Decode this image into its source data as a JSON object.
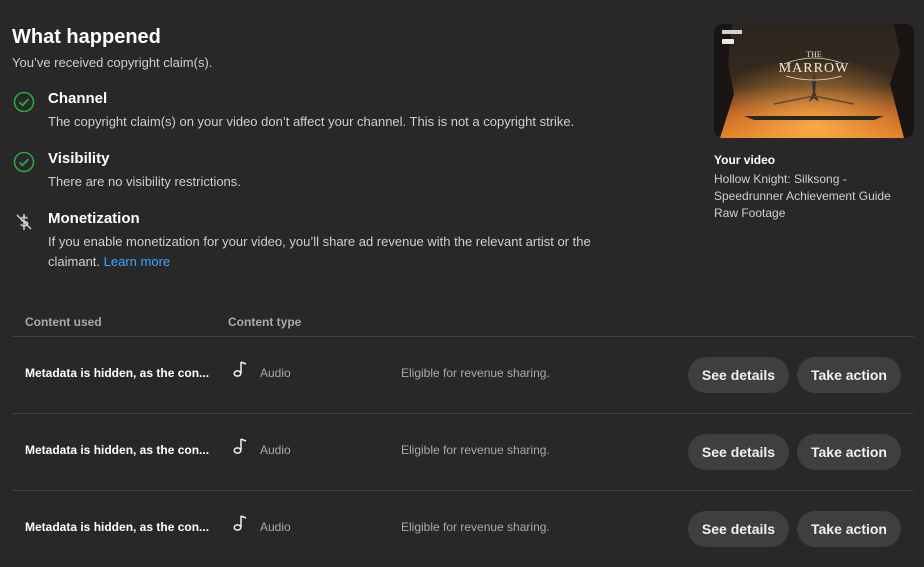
{
  "header": {
    "title": "What happened",
    "subtitle": "You’ve received copyright claim(s)."
  },
  "statuses": [
    {
      "title": "Channel",
      "desc": "The copyright claim(s) on your video don’t affect your channel. This is not a copyright strike."
    },
    {
      "title": "Visibility",
      "desc": "There are no visibility restrictions."
    },
    {
      "title": "Monetization",
      "desc": "If you enable monetization for your video, you’ll share ad revenue with the relevant artist or the claimant.",
      "link": "Learn more"
    }
  ],
  "video": {
    "label": "Your video",
    "title": "Hollow Knight: Silksong - Speedrunner Achievement Guide Raw Footage",
    "thumbnail_text_top": "THE",
    "thumbnail_text": "MARROW"
  },
  "table": {
    "headers": {
      "content_used": "Content used",
      "content_type": "Content type"
    },
    "rows": [
      {
        "content": "Metadata is hidden, as the con...",
        "type": "Audio",
        "revenue": "Eligible for revenue sharing.",
        "details_label": "See details",
        "action_label": "Take action"
      },
      {
        "content": "Metadata is hidden, as the con...",
        "type": "Audio",
        "revenue": "Eligible for revenue sharing.",
        "details_label": "See details",
        "action_label": "Take action"
      },
      {
        "content": "Metadata is hidden, as the con...",
        "type": "Audio",
        "revenue": "Eligible for revenue sharing.",
        "details_label": "See details",
        "action_label": "Take action"
      }
    ]
  },
  "colors": {
    "background": "#282828",
    "check": "#2ba640",
    "link": "#3ea6ff",
    "button": "#3f3f3f"
  },
  "icons": [
    "check-circle-icon",
    "monetization-off-icon",
    "music-note-icon"
  ]
}
